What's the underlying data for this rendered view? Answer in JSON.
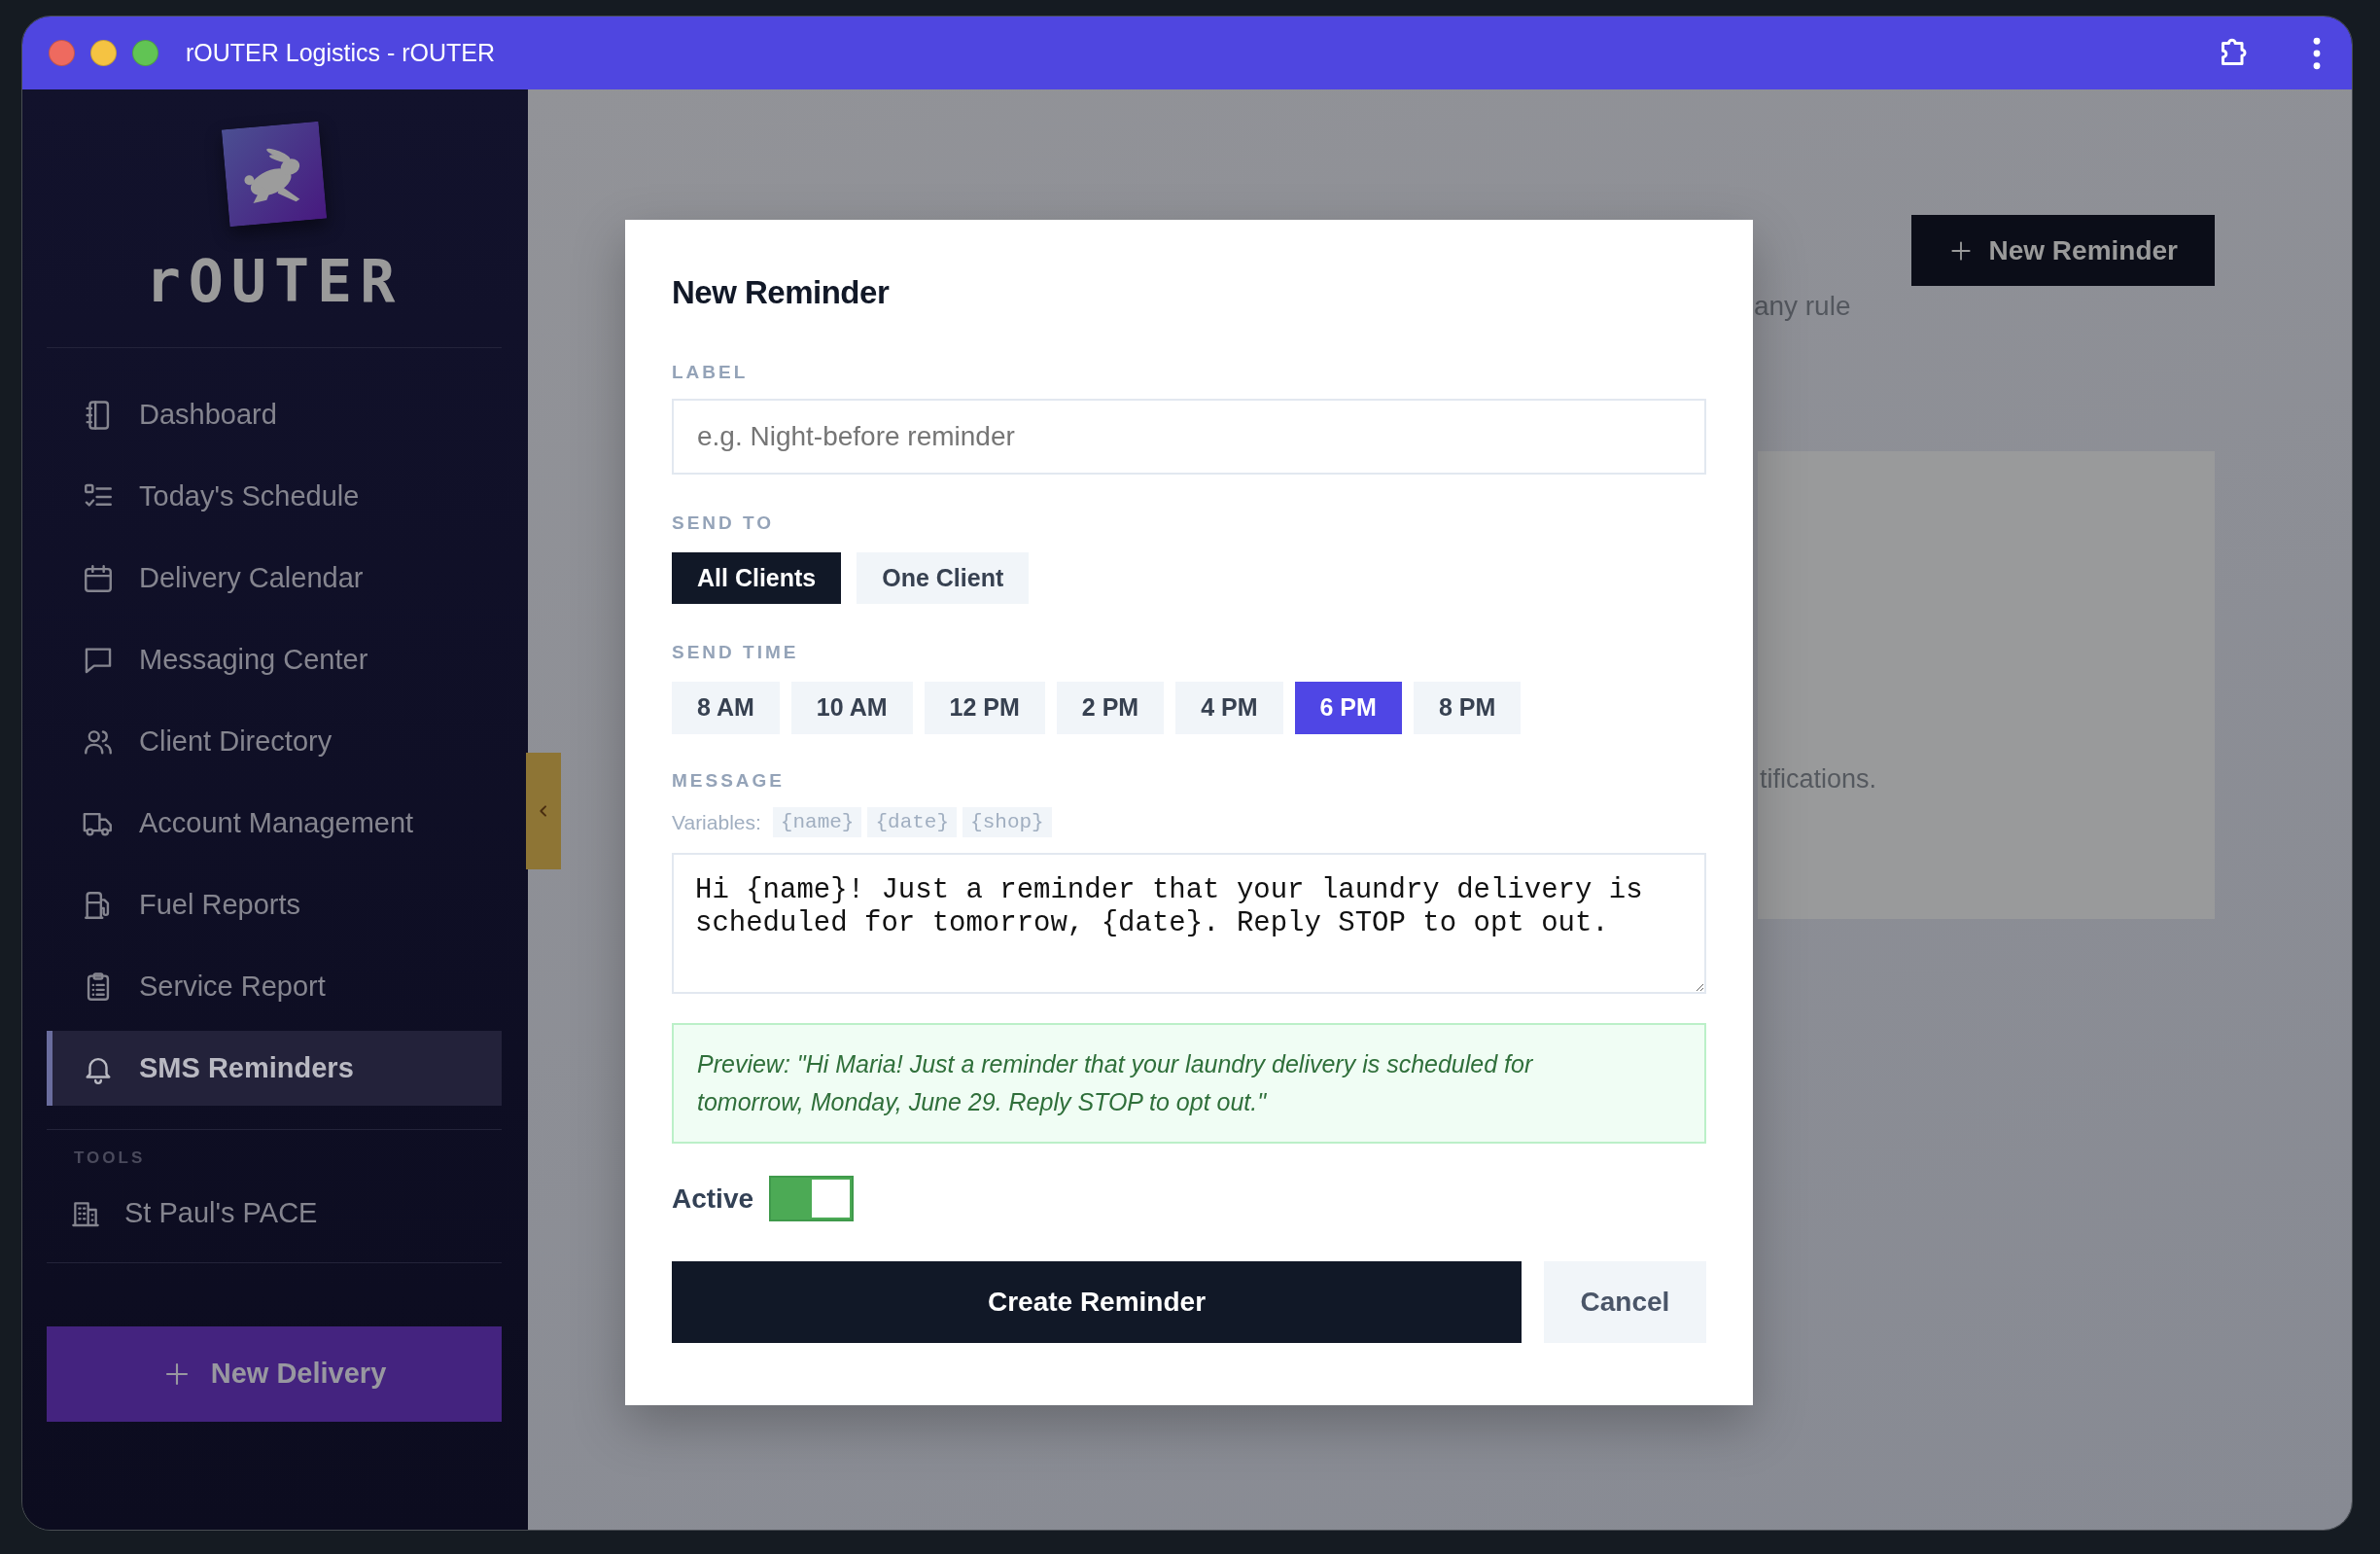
{
  "window": {
    "title": "rOUTER Logistics - rOUTER"
  },
  "sidebar": {
    "brand": "rOUTER",
    "items": [
      {
        "label": "Dashboard",
        "selected": false
      },
      {
        "label": "Today's Schedule",
        "selected": false
      },
      {
        "label": "Delivery Calendar",
        "selected": false
      },
      {
        "label": "Messaging Center",
        "selected": false
      },
      {
        "label": "Client Directory",
        "selected": false
      },
      {
        "label": "Account Management",
        "selected": false
      },
      {
        "label": "Fuel Reports",
        "selected": false
      },
      {
        "label": "Service Report",
        "selected": false
      },
      {
        "label": "SMS Reminders",
        "selected": true
      }
    ],
    "tools_heading": "TOOLS",
    "tools": [
      {
        "label": "St Paul's PACE",
        "selected": false
      }
    ],
    "new_delivery_button": "New Delivery"
  },
  "page": {
    "subtitle": "any rule",
    "new_reminder_button": "New Reminder",
    "empty_state": "tifications."
  },
  "modal": {
    "title": "New Reminder",
    "label_field": {
      "label": "LABEL",
      "placeholder": "e.g. Night-before reminder"
    },
    "send_to": {
      "label": "SEND TO",
      "options": [
        {
          "label": "All Clients",
          "selected": true
        },
        {
          "label": "One Client",
          "selected": false
        }
      ]
    },
    "send_time": {
      "label": "SEND TIME",
      "options": [
        {
          "label": "8 AM",
          "selected": false
        },
        {
          "label": "10 AM",
          "selected": false
        },
        {
          "label": "12 PM",
          "selected": false
        },
        {
          "label": "2 PM",
          "selected": false
        },
        {
          "label": "4 PM",
          "selected": false
        },
        {
          "label": "6 PM",
          "selected": true
        },
        {
          "label": "8 PM",
          "selected": false
        }
      ]
    },
    "message": {
      "label": "MESSAGE",
      "variables_label": "Variables:",
      "variables": [
        "{name}",
        "{date}",
        "{shop}"
      ],
      "value": "Hi {name}! Just a reminder that your laundry delivery is scheduled for tomorrow, {date}. Reply STOP to opt out."
    },
    "preview": "Preview: \"Hi Maria! Just a reminder that your laundry delivery is scheduled for tomorrow, Monday, June 29. Reply STOP to opt out.\"",
    "active": {
      "label": "Active",
      "on": true
    },
    "create_button": "Create Reminder",
    "cancel_button": "Cancel"
  }
}
